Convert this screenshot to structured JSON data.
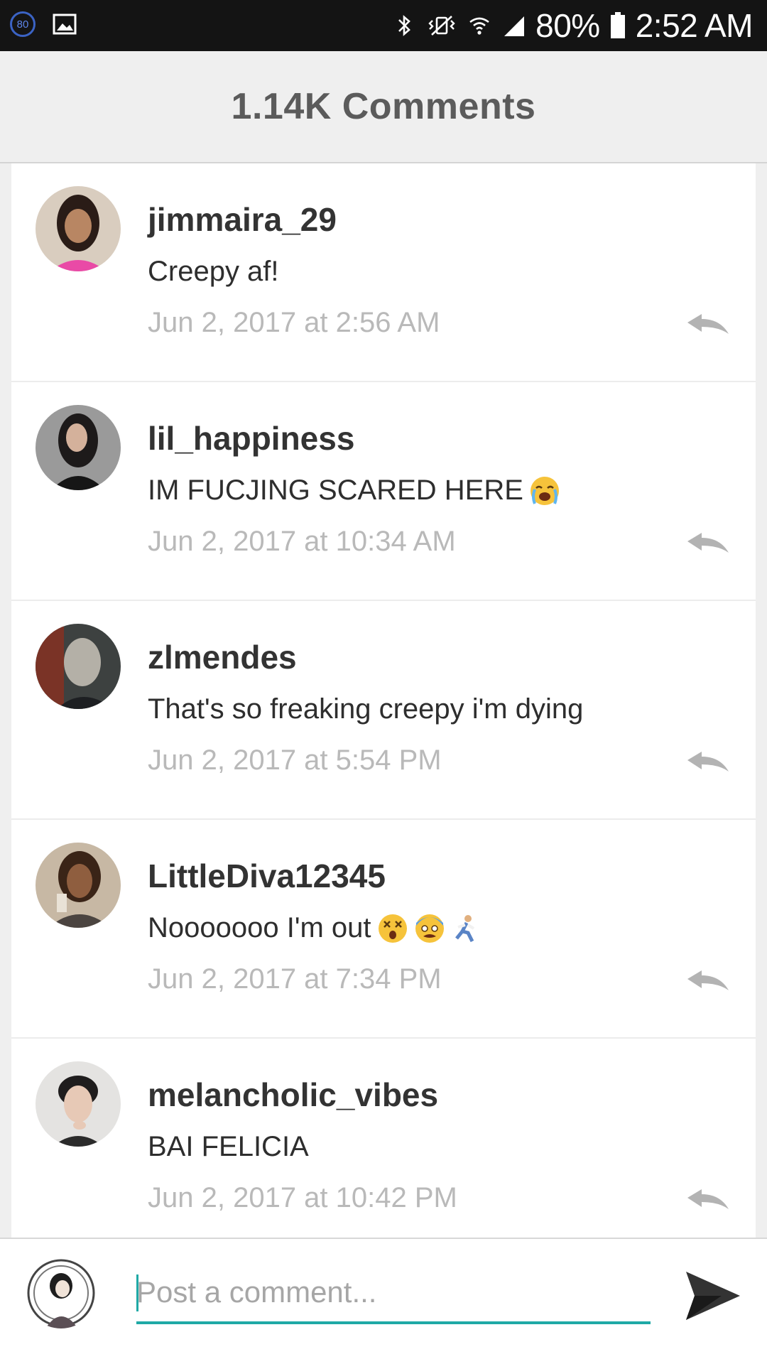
{
  "status_bar": {
    "notification_badge": "80",
    "battery_percent": "80%",
    "time": "2:52 AM"
  },
  "header": {
    "title": "1.14K Comments"
  },
  "comments": [
    {
      "username": "jimmaira_29",
      "text": "Creepy af!",
      "timestamp": "Jun 2, 2017 at 2:56 AM",
      "emojis": []
    },
    {
      "username": "lil_happiness",
      "text": "IM FUCJING SCARED HERE",
      "timestamp": "Jun 2, 2017 at 10:34 AM",
      "emojis": [
        "loudly-crying-face"
      ]
    },
    {
      "username": "zlmendes",
      "text": "That's so freaking creepy i'm dying",
      "timestamp": "Jun 2, 2017 at 5:54 PM",
      "emojis": []
    },
    {
      "username": "LittleDiva12345",
      "text": "Nooooooo I'm out",
      "timestamp": "Jun 2, 2017 at 7:34 PM",
      "emojis": [
        "dizzy-face",
        "screaming-face",
        "running-person"
      ]
    },
    {
      "username": "melancholic_vibes",
      "text": "BAI FELICIA",
      "timestamp": "Jun 2, 2017 at 10:42 PM",
      "emojis": []
    }
  ],
  "composer": {
    "placeholder": "Post a comment..."
  },
  "colors": {
    "accent": "#1fa9a6",
    "header_bg": "#efefef",
    "timestamp": "#b9b9b9"
  }
}
